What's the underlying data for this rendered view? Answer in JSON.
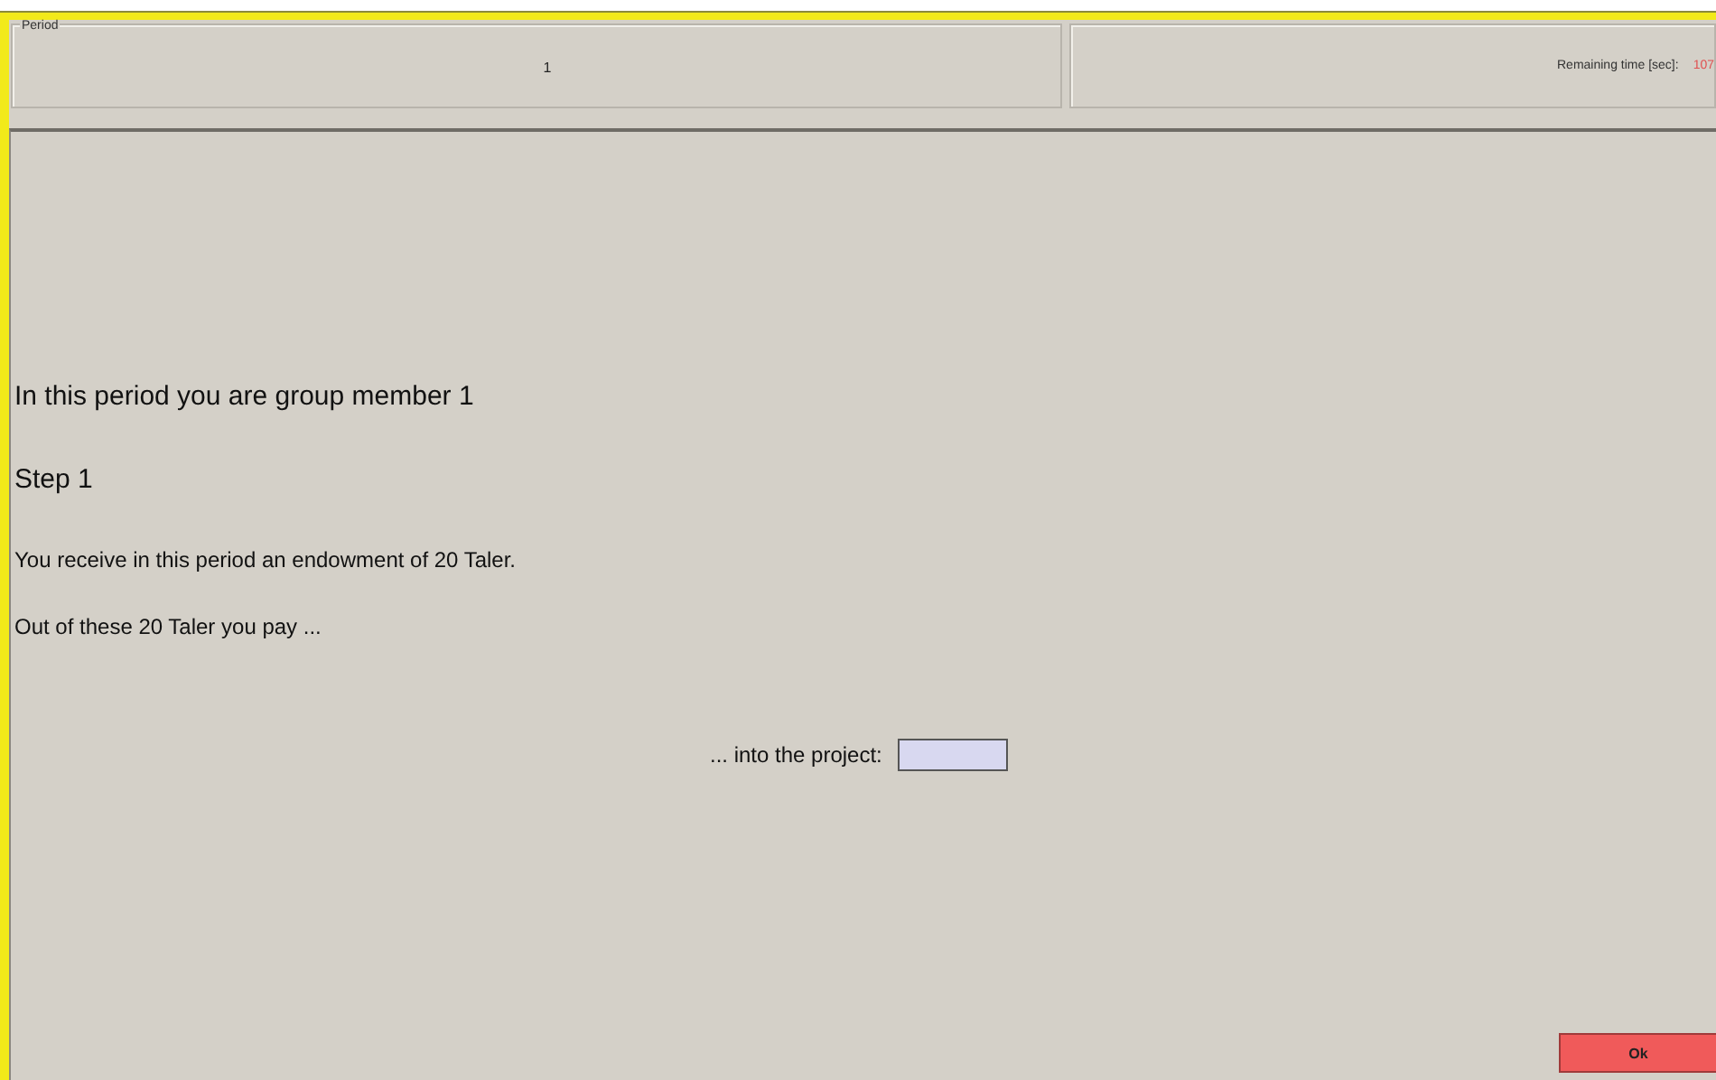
{
  "period": {
    "label": "Period",
    "value": "1"
  },
  "remaining_time": {
    "label": "Remaining time [sec]:",
    "value": "107"
  },
  "texts": [
    {
      "kind": "large",
      "text": "In this period you are group member 1"
    },
    {
      "kind": "large",
      "text": "Step 1"
    },
    {
      "kind": "small",
      "text": "You receive in this period an endowment of 20 Taler."
    },
    {
      "kind": "small",
      "text": "Out of these 20 Taler you pay ..."
    }
  ],
  "input": {
    "label": "... into the project:"
  },
  "ok_button": "Ok"
}
